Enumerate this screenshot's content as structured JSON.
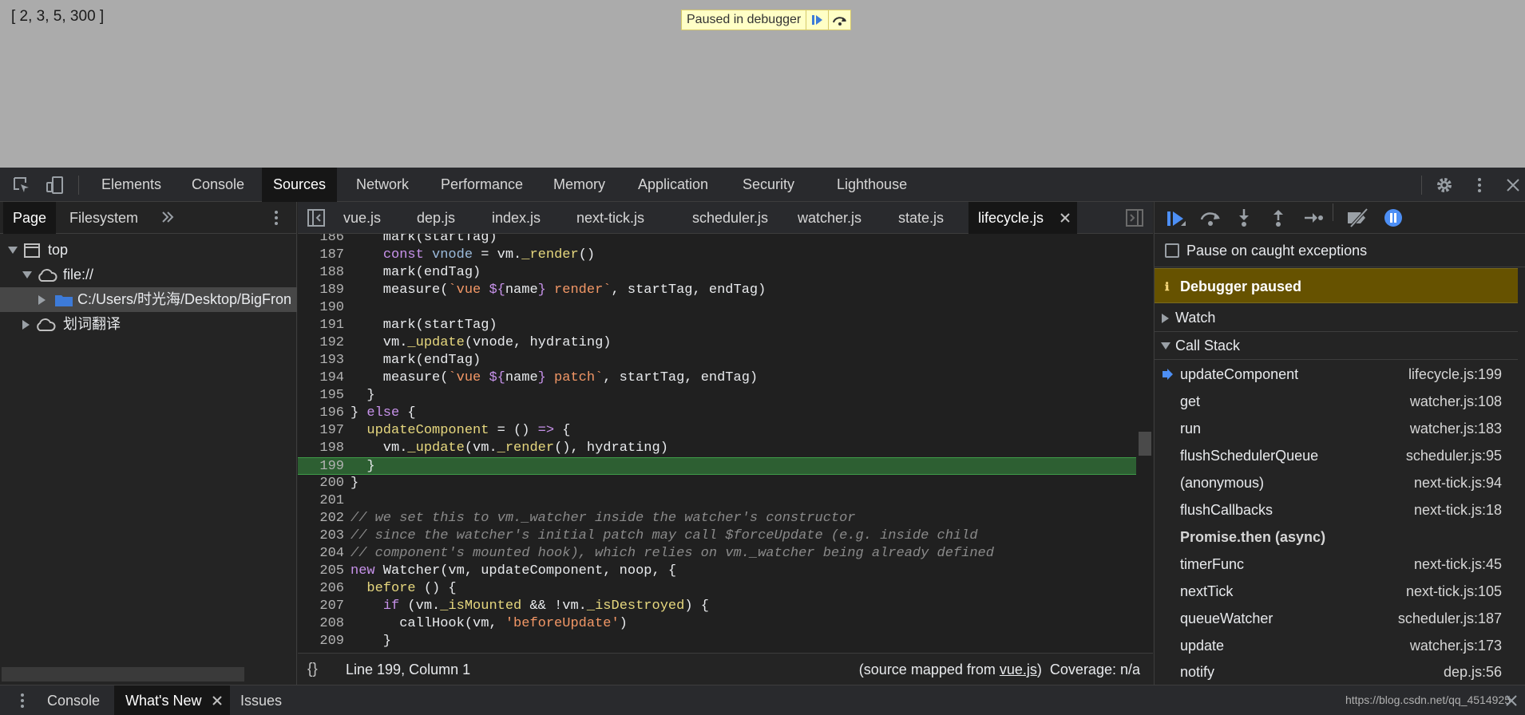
{
  "page": {
    "output": "[ 2, 3, 5, 300 ]",
    "paused_label": "Paused in debugger"
  },
  "main_tabs": [
    "Elements",
    "Console",
    "Sources",
    "Network",
    "Performance",
    "Memory",
    "Application",
    "Security",
    "Lighthouse"
  ],
  "navigator": {
    "tabs": [
      "Page",
      "Filesystem"
    ],
    "tree": [
      "top",
      "file://",
      "C:/Users/时光海/Desktop/BigFron",
      "划词翻译"
    ]
  },
  "file_tabs": [
    "vue.js",
    "dep.js",
    "index.js",
    "next-tick.js",
    "scheduler.js",
    "watcher.js",
    "state.js",
    "lifecycle.js"
  ],
  "code": {
    "line_numbers": [
      "186",
      "187",
      "188",
      "189",
      "190",
      "191",
      "192",
      "193",
      "194",
      "195",
      "196",
      "197",
      "198",
      "199",
      "200",
      "201",
      "202",
      "203",
      "204",
      "205",
      "206",
      "207",
      "208",
      "209"
    ],
    "highlight_line": "199"
  },
  "status": {
    "position": "Line 199, Column 1",
    "source_mapped_prefix": "(source mapped from ",
    "source_mapped_link": "vue.js",
    "source_mapped_suffix": ")",
    "coverage": "Coverage: n/a"
  },
  "debugger": {
    "pause_caught": "Pause on caught exceptions",
    "paused_banner": "Debugger paused",
    "watch": "Watch",
    "call_stack": "Call Stack",
    "frames": [
      {
        "name": "updateComponent",
        "loc": "lifecycle.js:199"
      },
      {
        "name": "get",
        "loc": "watcher.js:108"
      },
      {
        "name": "run",
        "loc": "watcher.js:183"
      },
      {
        "name": "flushSchedulerQueue",
        "loc": "scheduler.js:95"
      },
      {
        "name": "(anonymous)",
        "loc": "next-tick.js:94"
      },
      {
        "name": "flushCallbacks",
        "loc": "next-tick.js:18"
      }
    ],
    "async_label": "Promise.then (async)",
    "frames_after": [
      {
        "name": "timerFunc",
        "loc": "next-tick.js:45"
      },
      {
        "name": "nextTick",
        "loc": "next-tick.js:105"
      },
      {
        "name": "queueWatcher",
        "loc": "scheduler.js:187"
      },
      {
        "name": "update",
        "loc": "watcher.js:173"
      },
      {
        "name": "notify",
        "loc": "dep.js:56"
      }
    ]
  },
  "drawer": {
    "tabs": [
      "Console",
      "What's New",
      "Issues"
    ],
    "watermark": "https://blog.csdn.net/qq_4514925"
  },
  "colors": {
    "accent": "#4d8ff5",
    "highlight": "#2d5f32",
    "paused_banner": "#665200"
  },
  "icons": [
    "inspect-icon",
    "device-toggle-icon",
    "settings-gear-icon",
    "more-options-icon",
    "close-devtools-icon",
    "resume-icon",
    "step-over-icon",
    "step-into-icon",
    "step-out-icon",
    "step-icon",
    "deactivate-breakpoints-icon",
    "pause-on-exceptions-icon"
  ]
}
